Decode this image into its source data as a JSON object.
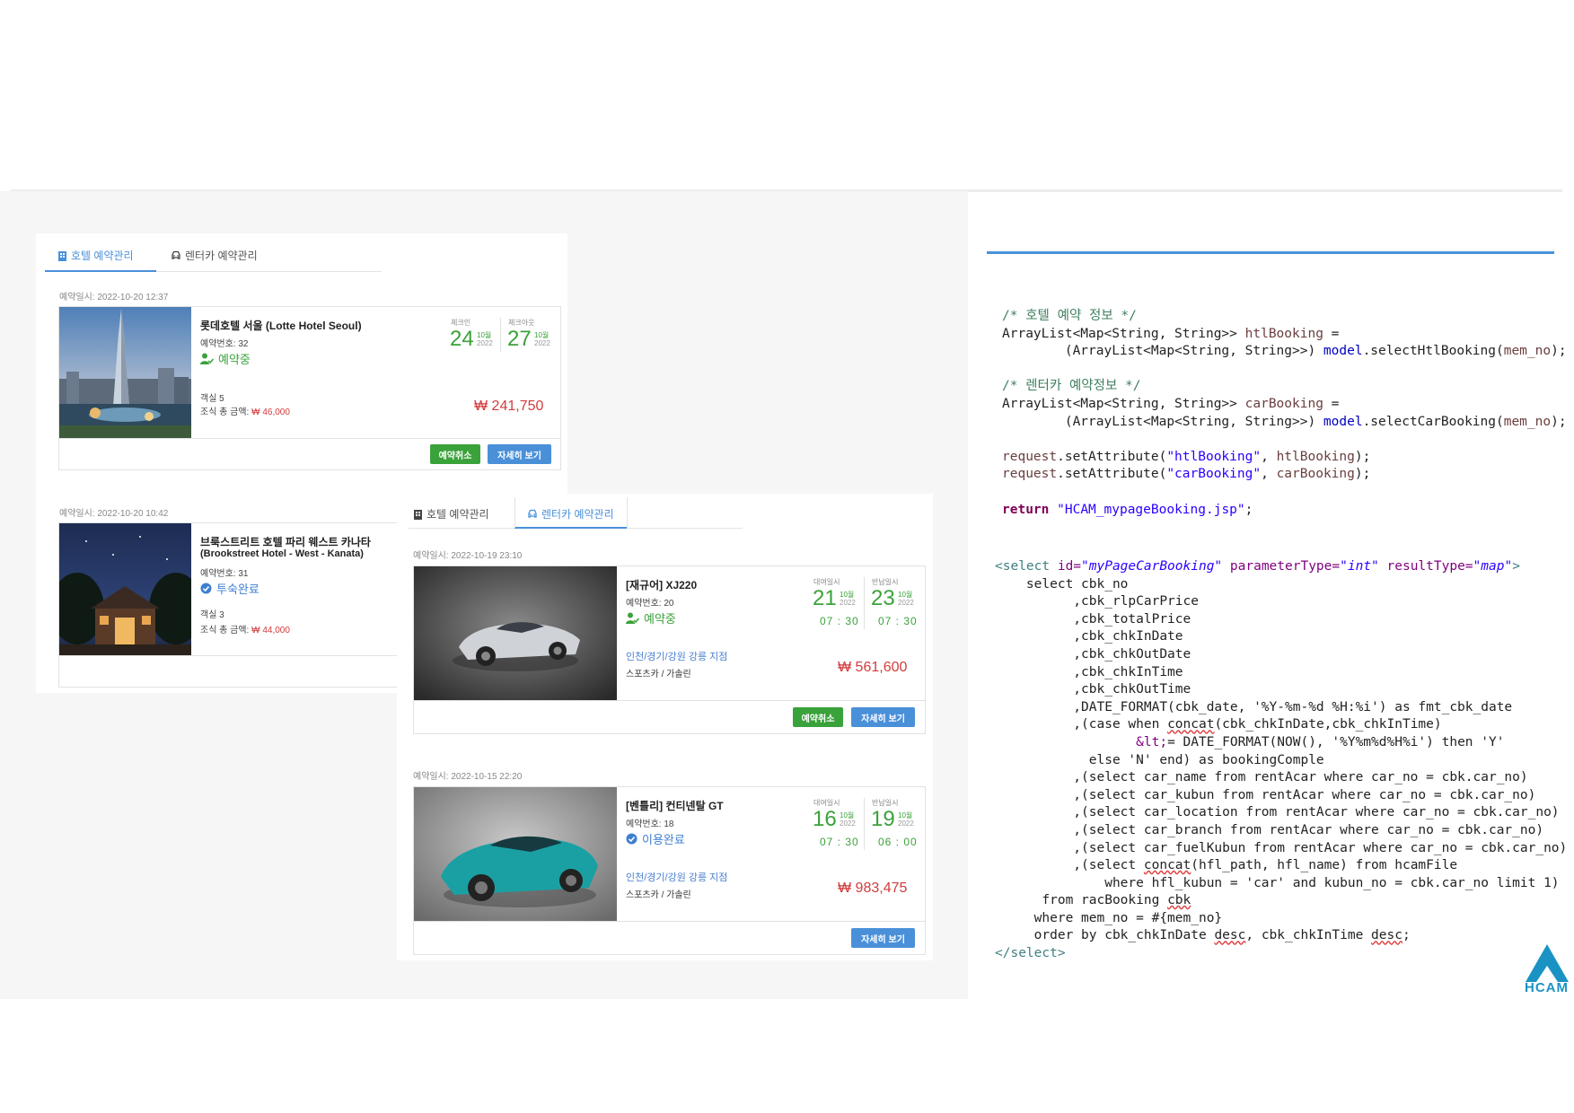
{
  "hotel_tabs": {
    "hotel": "호텔 예약관리",
    "car": "렌터카 예약관리"
  },
  "hotels": [
    {
      "date": "예약일시: 2022-10-20 12:37",
      "name": "롯데호텔 서울 (Lotte Hotel Seoul)",
      "booking_no": "예약번호: 32",
      "status": "예약중",
      "checkin_label": "체크인",
      "checkout_label": "체크아웃",
      "in_day": "24",
      "in_month": "10월",
      "in_year": "2022",
      "out_day": "27",
      "out_month": "10월",
      "out_year": "2022",
      "rooms": "객실 5",
      "breakfast_label": "조식 총 금액: ",
      "breakfast_amount": "₩ 46,000",
      "price": "₩ 241,750",
      "cancel_button": "예약취소",
      "detail_button": "자세히 보기"
    },
    {
      "date": "예약일시: 2022-10-20 10:42",
      "name": "브룩스트리트 호텔 파리 웨스트 카나타",
      "name2": "(Brookstreet Hotel - West - Kanata)",
      "booking_no": "예약번호: 31",
      "status": "투숙완료",
      "rooms": "객실 3",
      "breakfast_label": "조식 총 금액: ",
      "breakfast_amount": "₩ 44,000"
    }
  ],
  "cars": [
    {
      "date": "예약일시: 2022-10-19 23:10",
      "name": "[재규어] XJ220",
      "booking_no": "예약번호: 20",
      "status": "예약중",
      "rent_label": "대여일시",
      "return_label": "반납일시",
      "in_day": "21",
      "in_month": "10월",
      "in_year": "2022",
      "out_day": "23",
      "out_month": "10월",
      "out_year": "2022",
      "in_time": "07 : 30",
      "out_time": "07 : 30",
      "location": "인천/경기/강원 강릉 지점",
      "category": "스포츠카 / 가솔린",
      "price": "₩ 561,600",
      "cancel_button": "예약취소",
      "detail_button": "자세히 보기"
    },
    {
      "date": "예약일시: 2022-10-15 22:20",
      "name": "[벤틀리] 컨티넨탈 GT",
      "booking_no": "예약번호: 18",
      "status": "이용완료",
      "rent_label": "대여일시",
      "return_label": "반납일시",
      "in_day": "16",
      "in_month": "10월",
      "in_year": "2022",
      "out_day": "19",
      "out_month": "10월",
      "out_year": "2022",
      "in_time": "07 : 30",
      "out_time": "06 : 00",
      "location": "인천/경기/강원 강릉 지점",
      "category": "스포츠카 / 가솔린",
      "price": "₩ 983,475",
      "detail_button": "자세히 보기"
    }
  ],
  "code": {
    "java": {
      "c1": "/* 호텔 예약 정보 */",
      "l1a": "ArrayList<Map<String, String>> ",
      "l1v": "htlBooking",
      "l1b": " =",
      "l2a": "        (ArrayList<Map<String, String>>) ",
      "l2f": "model",
      "l2b": ".selectHtlBooking(",
      "l2v": "mem_no",
      "l2c": ");",
      "c2": "/* 렌터카 예약정보 */",
      "l3a": "ArrayList<Map<String, String>> ",
      "l3v": "carBooking",
      "l3b": " =",
      "l4a": "        (ArrayList<Map<String, String>>) ",
      "l4f": "model",
      "l4b": ".selectCarBooking(",
      "l4v": "mem_no",
      "l4c": ");",
      "r1a": "request",
      "r1b": ".setAttribute(",
      "r1s": "\"htlBooking\"",
      "r1c": ", ",
      "r1v": "htlBooking",
      "r1d": ");",
      "r2a": "request",
      "r2b": ".setAttribute(",
      "r2s": "\"carBooking\"",
      "r2c": ", ",
      "r2v": "carBooking",
      "r2d": ");",
      "ret_kw": "return",
      "ret_str": "\"HCAM_mypageBooking.jsp\"",
      "ret_end": ";"
    },
    "sql": {
      "open_tag": "<select",
      "id_attr": " id=",
      "id_val": "\"myPageCarBooking\"",
      "pt_attr": " parameterType=",
      "pt_val": "\"int\"",
      "rt_attr": " resultType=",
      "rt_val": "\"map\"",
      "open_end": ">",
      "s1": "    select cbk_no",
      "s2": "          ,cbk_rlpCarPrice",
      "s3": "          ,cbk_totalPrice",
      "s4": "          ,cbk_chkInDate",
      "s5": "          ,cbk_chkOutDate",
      "s6": "          ,cbk_chkInTime",
      "s7": "          ,cbk_chkOutTime",
      "s8": "          ,DATE_FORMAT(cbk_date, '%Y-%m-%d %H:%i') as fmt_cbk_date",
      "s9a": "          ,(case when ",
      "s9b": "concat",
      "s9c": "(cbk_chkInDate,cbk_chkInTime)",
      "s10a": "                  ",
      "s10b": "&lt;",
      "s10c": "= DATE_FORMAT(NOW(), '%Y%m%d%H%i') then 'Y'",
      "s11": "            else 'N' end) as bookingComple",
      "s12": "          ,(select car_name from rentAcar where car_no = cbk.car_no)",
      "s13": "          ,(select car_kubun from rentAcar where car_no = cbk.car_no)",
      "s14": "          ,(select car_location from rentAcar where car_no = cbk.car_no)",
      "s15": "          ,(select car_branch from rentAcar where car_no = cbk.car_no)",
      "s16": "          ,(select car_fuelKubun from rentAcar where car_no = cbk.car_no)",
      "s17a": "          ,(select ",
      "s17b": "concat",
      "s17c": "(hfl_path, hfl_name) from hcamFile",
      "s18": "              where hfl_kubun = 'car' and kubun_no = cbk.car_no limit 1)",
      "s19a": "      from racBooking ",
      "s19b": "cbk",
      "s20": "     where mem_no = #{mem_no}",
      "s21a": "     order by cbk_chkInDate ",
      "s21b": "desc",
      "s21c": ", cbk_chkInTime ",
      "s21d": "desc",
      "s21e": ";",
      "close_tag": "</select>"
    }
  },
  "logo": {
    "text": "HCAM"
  },
  "colors": {
    "accent_blue": "#4a90d9",
    "status_green": "#3aa23a",
    "price_red": "#d33b3b",
    "logo_blue": "#1a93c4"
  }
}
